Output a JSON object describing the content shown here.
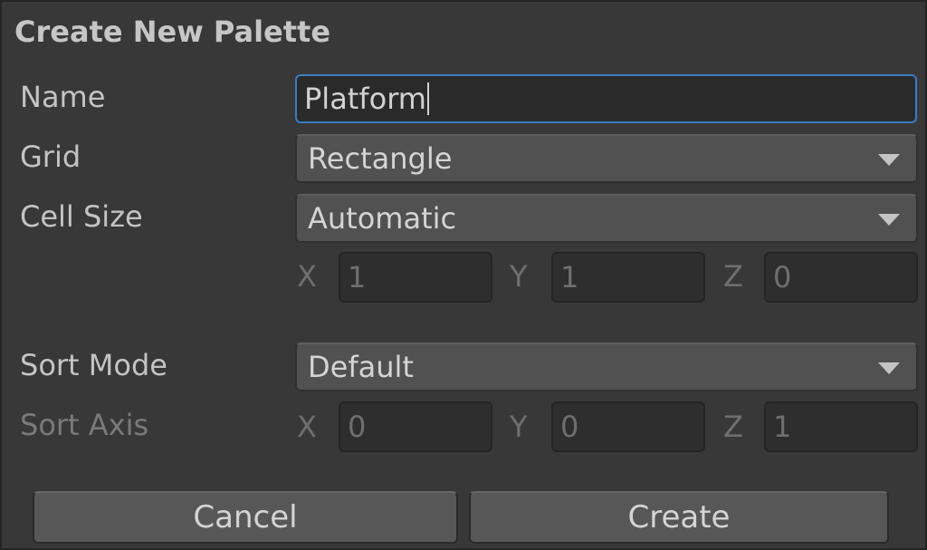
{
  "window": {
    "title": "Create New Palette"
  },
  "fields": {
    "name": {
      "label": "Name",
      "value": "Platform"
    },
    "grid": {
      "label": "Grid",
      "value": "Rectangle"
    },
    "cell_size": {
      "label": "Cell Size",
      "value": "Automatic",
      "x_label": "X",
      "x_value": "1",
      "y_label": "Y",
      "y_value": "1",
      "z_label": "Z",
      "z_value": "0"
    },
    "sort_mode": {
      "label": "Sort Mode",
      "value": "Default"
    },
    "sort_axis": {
      "label": "Sort Axis",
      "x_label": "X",
      "x_value": "0",
      "y_label": "Y",
      "y_value": "0",
      "z_label": "Z",
      "z_value": "1"
    }
  },
  "buttons": {
    "cancel": "Cancel",
    "create": "Create"
  },
  "colors": {
    "background": "#383838",
    "focus_border": "#3b7cc4",
    "disabled_text": "#6f6f6f"
  },
  "icons": {
    "dropdown": "triangle-down-icon"
  }
}
